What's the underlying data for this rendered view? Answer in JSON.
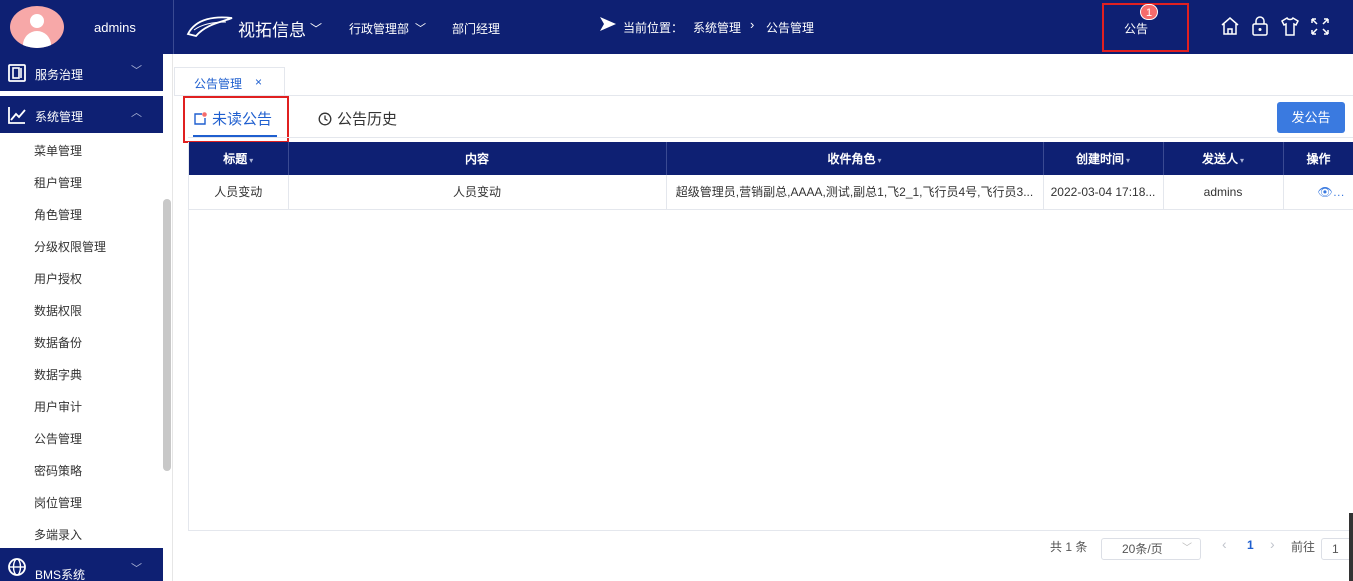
{
  "user": {
    "name": "admins"
  },
  "header": {
    "brand": "视拓信息",
    "department": "行政管理部",
    "role": "部门经理",
    "location_label": "当前位置：",
    "breadcrumb": [
      "系统管理",
      "公告管理"
    ],
    "notice_label": "公告",
    "notice_badge": "1"
  },
  "sidebar": {
    "groups": [
      {
        "label": "服务治理"
      },
      {
        "label": "系统管理"
      },
      {
        "label": "BMS系统"
      }
    ],
    "items": [
      "菜单管理",
      "租户管理",
      "角色管理",
      "分级权限管理",
      "用户授权",
      "数据权限",
      "数据备份",
      "数据字典",
      "用户审计",
      "公告管理",
      "密码策略",
      "岗位管理",
      "多端录入"
    ]
  },
  "page_tab": {
    "label": "公告管理",
    "close": "×"
  },
  "sub_tabs": {
    "unread": "未读公告",
    "history": "公告历史"
  },
  "publish_button": "发公告",
  "table": {
    "columns": [
      "标题",
      "内容",
      "收件角色",
      "创建时间",
      "发送人",
      "操作"
    ],
    "rows": [
      {
        "title": "人员变动",
        "content": "人员变动",
        "roles": "超级管理员,营销副总,AAAA,测试,副总1,飞2_1,飞行员4号,飞行员3...",
        "created": "2022-03-04 17:18...",
        "sender": "admins",
        "action": "详情"
      }
    ]
  },
  "pagination": {
    "total": "共 1 条",
    "page_size": "20条/页",
    "current_page": "1",
    "goto_label": "前往",
    "goto_value": "1"
  },
  "colors": {
    "navy": "#0e2073",
    "accent": "#1f5fcf",
    "button": "#3a7ae0",
    "highlight": "#e02020"
  }
}
